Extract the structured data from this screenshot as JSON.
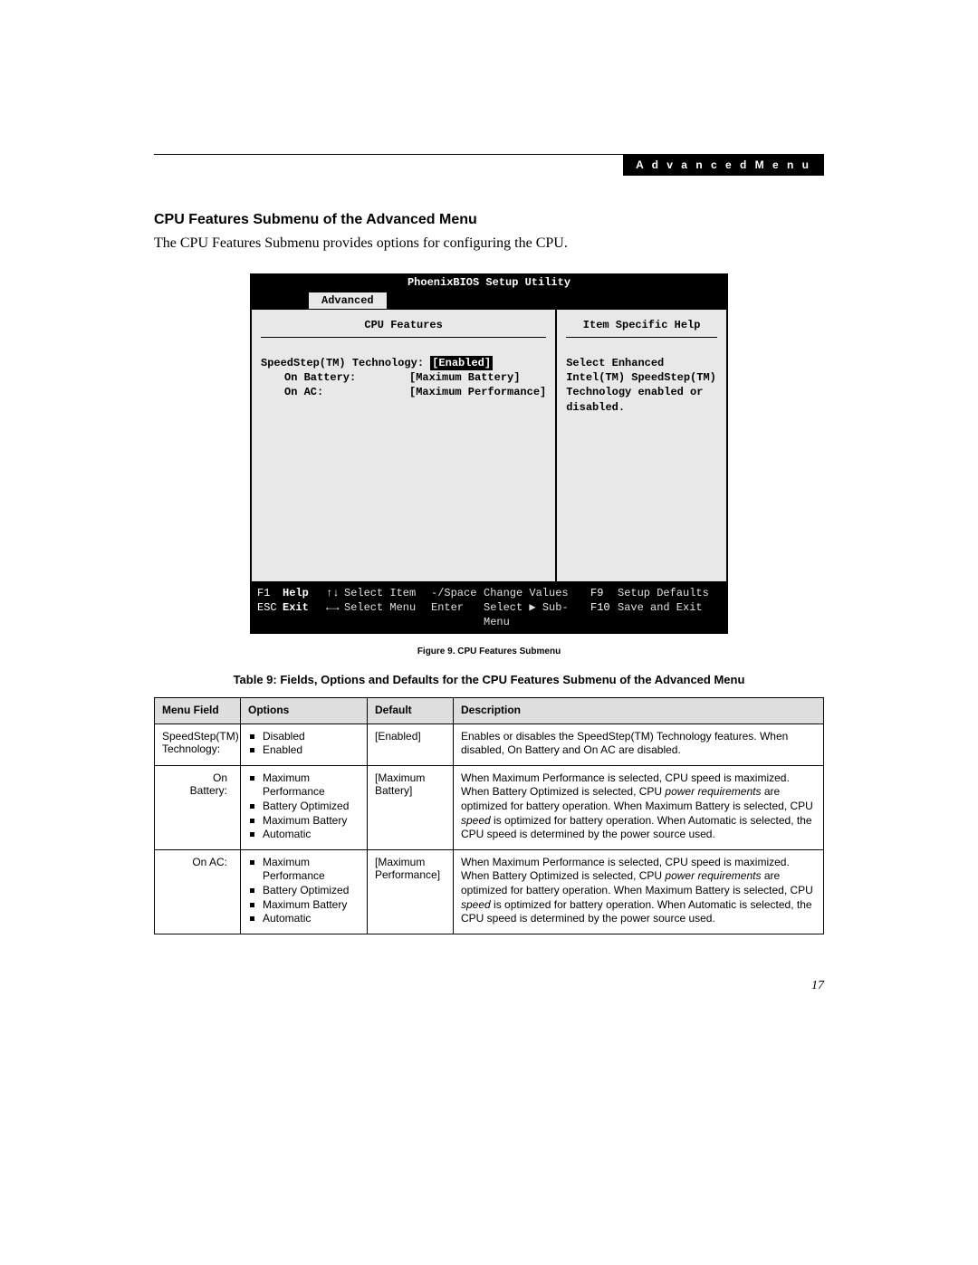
{
  "header": {
    "breadcrumb": "A d v a n c e d   M e n u"
  },
  "section": {
    "title": "CPU Features Submenu of the Advanced Menu",
    "intro": "The CPU Features Submenu provides options for configuring the CPU."
  },
  "bios": {
    "title": "PhoenixBIOS Setup Utility",
    "active_tab": "Advanced",
    "left_title": "CPU Features",
    "right_title": "Item Specific Help",
    "options": {
      "row0_label": "SpeedStep(TM) Technology:",
      "row0_value": "[Enabled]",
      "row1_label": "On Battery:",
      "row1_value": "[Maximum Battery]",
      "row2_label": "On AC:",
      "row2_value": "[Maximum Performance]"
    },
    "help_lines": [
      "Select Enhanced",
      "Intel(TM) SpeedStep(TM)",
      "Technology enabled or",
      "disabled."
    ],
    "footer": {
      "r0": {
        "k1": "F1",
        "l1": "Help",
        "a1": "↑↓",
        "t1": "Select Item",
        "k2": "-/Space",
        "t2": "Change Values",
        "k3": "F9",
        "t3": "Setup Defaults"
      },
      "r1": {
        "k1": "ESC",
        "l1": "Exit",
        "a1": "←→",
        "t1": "Select Menu",
        "k2": "Enter",
        "t2": "Select ▶ Sub-Menu",
        "k3": "F10",
        "t3": "Save and Exit"
      }
    }
  },
  "figure_caption": "Figure 9.  CPU Features Submenu",
  "table_caption": "Table 9: Fields, Options and Defaults for the CPU Features Submenu of the Advanced Menu",
  "table": {
    "headers": [
      "Menu Field",
      "Options",
      "Default",
      "Description"
    ],
    "rows": [
      {
        "field": "SpeedStep(TM) Technology:",
        "indent": false,
        "options": [
          "Disabled",
          "Enabled"
        ],
        "default": "[Enabled]",
        "desc_html": "Enables or disables the SpeedStep(TM) Technology features. When disabled, On Battery and On AC are disabled."
      },
      {
        "field": "On Battery:",
        "indent": true,
        "options": [
          "Maximum Performance",
          "Battery Optimized",
          "Maximum Battery",
          "Automatic"
        ],
        "default": "[Maximum Battery]",
        "desc_html": "When Maximum Performance is selected, CPU speed is maximized. When Battery Optimized is selected, CPU <i>power requirements</i> are optimized for battery operation. When Maximum Battery is selected, CPU <i>speed</i> is optimized for battery operation. When Automatic is selected, the CPU speed is determined by the power source used."
      },
      {
        "field": "On AC:",
        "indent": true,
        "options": [
          "Maximum Performance",
          "Battery Optimized",
          "Maximum Battery",
          "Automatic"
        ],
        "default": "[Maximum Performance]",
        "desc_html": "When Maximum Performance is selected, CPU speed is maximized. When Battery Optimized is selected, CPU <i>power requirements</i> are optimized for battery operation. When Maximum Battery is selected, CPU <i>speed</i> is optimized for battery operation. When Automatic is selected, the CPU speed is determined by the power source used."
      }
    ]
  },
  "page_number": "17"
}
